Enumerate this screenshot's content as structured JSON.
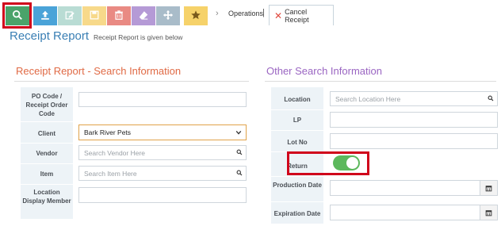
{
  "toolbar": {
    "buttons": [
      {
        "name": "search",
        "icon": "search-icon",
        "color": "#4aa36a"
      },
      {
        "name": "upload",
        "icon": "upload-icon",
        "color": "#4aa3d8"
      },
      {
        "name": "edit",
        "icon": "edit-icon",
        "color": "#b9dcd4"
      },
      {
        "name": "save",
        "icon": "save-icon",
        "color": "#f7d98a"
      },
      {
        "name": "delete",
        "icon": "trash-icon",
        "color": "#e98a83"
      },
      {
        "name": "clear",
        "icon": "eraser-icon",
        "color": "#b59ad6"
      },
      {
        "name": "move",
        "icon": "move-icon",
        "color": "#a9bcc9"
      },
      {
        "name": "favorite",
        "icon": "star-icon",
        "color": "#f6d26a"
      }
    ],
    "breadcrumb_sep": "›",
    "breadcrumb": "Operations",
    "breadcrumb_bar": "|",
    "cancel_tab": "Cancel Receipt"
  },
  "header": {
    "title": "Receipt Report",
    "subtitle": "Receipt Report is given below"
  },
  "left_section": {
    "title": "Receipt Report - Search Information",
    "fields": [
      {
        "label": "PO Code / Receipt Order Code",
        "value": "",
        "placeholder": ""
      },
      {
        "label": "Client",
        "value": "Bark River Pets",
        "type": "select"
      },
      {
        "label": "Vendor",
        "value": "",
        "placeholder": "Search Vendor Here"
      },
      {
        "label": "Item",
        "value": "",
        "placeholder": "Search Item Here"
      },
      {
        "label": "Location Display Member",
        "value": "",
        "placeholder": ""
      }
    ]
  },
  "right_section": {
    "title": "Other Search Information",
    "fields": [
      {
        "label": "Location",
        "value": "",
        "placeholder": "Search Location Here"
      },
      {
        "label": "LP",
        "value": ""
      },
      {
        "label": "Lot No",
        "value": ""
      },
      {
        "label": "Return",
        "value": "on",
        "type": "toggle"
      },
      {
        "label": "Production Date",
        "value": ""
      },
      {
        "label": "Expiration Date",
        "value": ""
      }
    ]
  },
  "colors": {
    "accent": "#3a7fb4",
    "left_title": "#e06a45",
    "right_title": "#9a65c2",
    "toggle_on": "#5cb85c",
    "highlight": "#d0021b"
  }
}
